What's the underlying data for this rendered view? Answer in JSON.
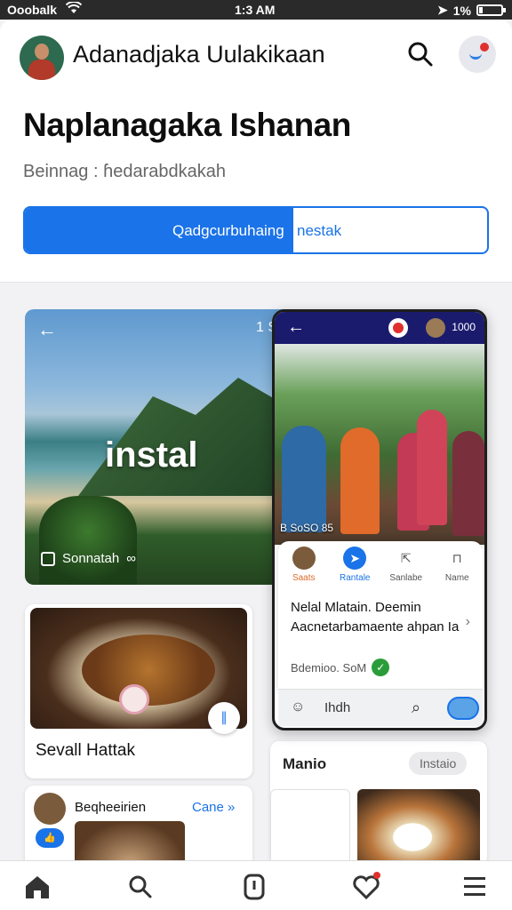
{
  "status_bar": {
    "carrier": "Ooobalk",
    "time": "1:3 AM",
    "battery": "1%",
    "battery_level": 0.15
  },
  "header": {
    "app_title": "Adanadjaka Uulakikaan",
    "page_title": "Naplanagaka Ishanan",
    "subtitle": "Beinnag : ɦedarabdkakah",
    "cta_label": "Qadgcurbuhaing",
    "cta_label_secondary": "nestak",
    "cta_progress": 0.58,
    "icons": {
      "search": "search-icon",
      "profile": "profile-icon"
    }
  },
  "hero_card": {
    "meta": "1 S",
    "overlay_text": "instal",
    "caption": "Sonnatah"
  },
  "phone_preview": {
    "count": "1000",
    "photo_caption": "B SoSO 85",
    "actions": [
      {
        "label": "Saats",
        "icon": "avatar-icon"
      },
      {
        "label": "Rantale",
        "icon": "share-icon"
      },
      {
        "label": "Sanlabe",
        "icon": "send-icon"
      },
      {
        "label": "Name",
        "icon": "bookmark-icon"
      }
    ],
    "sheet_title": "Nelal Mlatain. Deemin Aacnetarbamaente ahpan Ia",
    "sheet_meta": "Bdemioo. SoM",
    "search_text": "Ihdh"
  },
  "food_card": {
    "title": "Sevall Hattak"
  },
  "user_card": {
    "name": "Beqheeirien",
    "link": "Cane »"
  },
  "side_card": {
    "title": "Manio",
    "chip": "Instaio"
  },
  "bottom_nav": {
    "items": [
      "home-icon",
      "search-icon",
      "alert-icon",
      "heart-icon",
      "menu-icon"
    ]
  },
  "colors": {
    "accent": "#1a73e8",
    "status_bar": "#2a2a2a",
    "phone_topbar": "#1b1b6e",
    "badge": "#e0302e"
  }
}
